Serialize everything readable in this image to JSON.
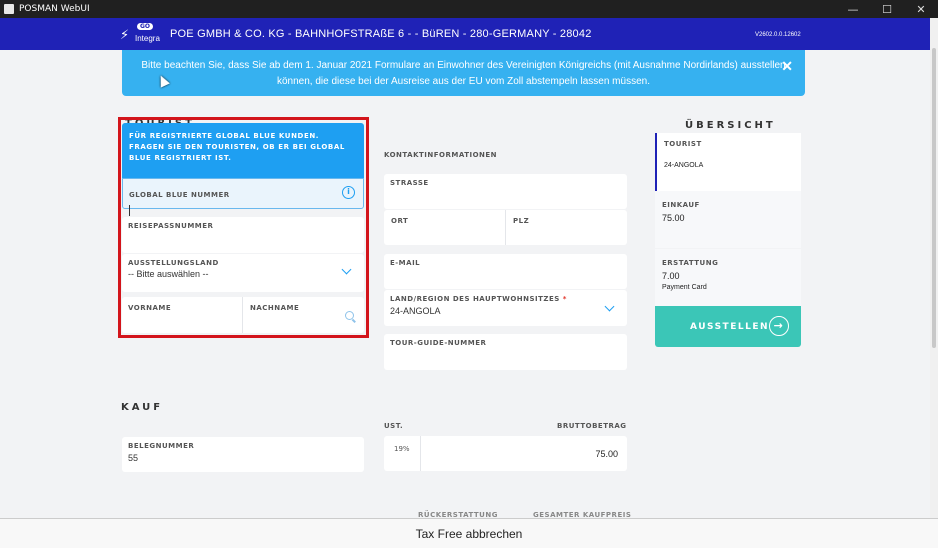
{
  "window": {
    "title": "POSMAN WebUI",
    "minimize": "—",
    "maximize": "☐",
    "close": "✕"
  },
  "header": {
    "badge": "GO",
    "brand": "Integra",
    "company": "POE GMBH & CO. KG - BAHNHOFSTRAßE 6 - - BüREN - 280-GERMANY - 28042",
    "version": "V2602.0.0.12602"
  },
  "notice": {
    "line1": "Bitte beachten Sie, dass Sie ab dem 1. Januar 2021 Formulare an Einwohner des Vereinigten Königreichs (mit Ausnahme Nordirlands) ausstellen",
    "line2": "können, die diese bei der Ausreise aus der EU vom Zoll abstempeln lassen müssen.",
    "close": "✕"
  },
  "tourist": {
    "section_title": "TOURIST",
    "banner": "FÜR REGISTRIERTE GLOBAL BLUE KUNDEN. FRAGEN SIE DEN TOURISTEN, OB ER BEI GLOBAL BLUE REGISTRIERT IST.",
    "global_blue_label": "GLOBAL BLUE NUMMER",
    "global_blue_value": "",
    "passport_label": "REISEPASSNUMMER",
    "country_label": "AUSSTELLUNGSLAND",
    "country_value": "-- Bitte auswählen --",
    "firstname_label": "VORNAME",
    "lastname_label": "NACHNAME"
  },
  "contact": {
    "section_title": "KONTAKTINFORMATIONEN",
    "street_label": "STRASSE",
    "city_label": "ORT",
    "zip_label": "PLZ",
    "email_label": "E-MAIL",
    "residence_label": "LAND/REGION DES HAUPTWOHNSITZES",
    "required_mark": "*",
    "residence_value": "24-ANGOLA",
    "guide_label": "TOUR-GUIDE-NUMMER"
  },
  "overview": {
    "section_title": "ÜBERSICHT",
    "tourist_label": "TOURIST",
    "tourist_value": "24-ANGOLA",
    "purchase_label": "EINKAUF",
    "purchase_value": "75.00",
    "refund_label": "ERSTATTUNG",
    "refund_value": "7.00",
    "refund_method": "Payment Card",
    "issue_button": "AUSSTELLEN",
    "issue_icon": "→"
  },
  "purchase": {
    "section_title": "KAUF",
    "receipt_label": "BELEGNUMMER",
    "receipt_value": "55",
    "vat_label": "UST.",
    "gross_label": "BRUTTOBETRAG",
    "vat_value": "19%",
    "gross_value": "75.00",
    "refund_col": "RÜCKERSTATTUNG",
    "total_col": "GESAMTER KAUFPREIS"
  },
  "footer": {
    "cancel": "Tax Free abbrechen"
  }
}
